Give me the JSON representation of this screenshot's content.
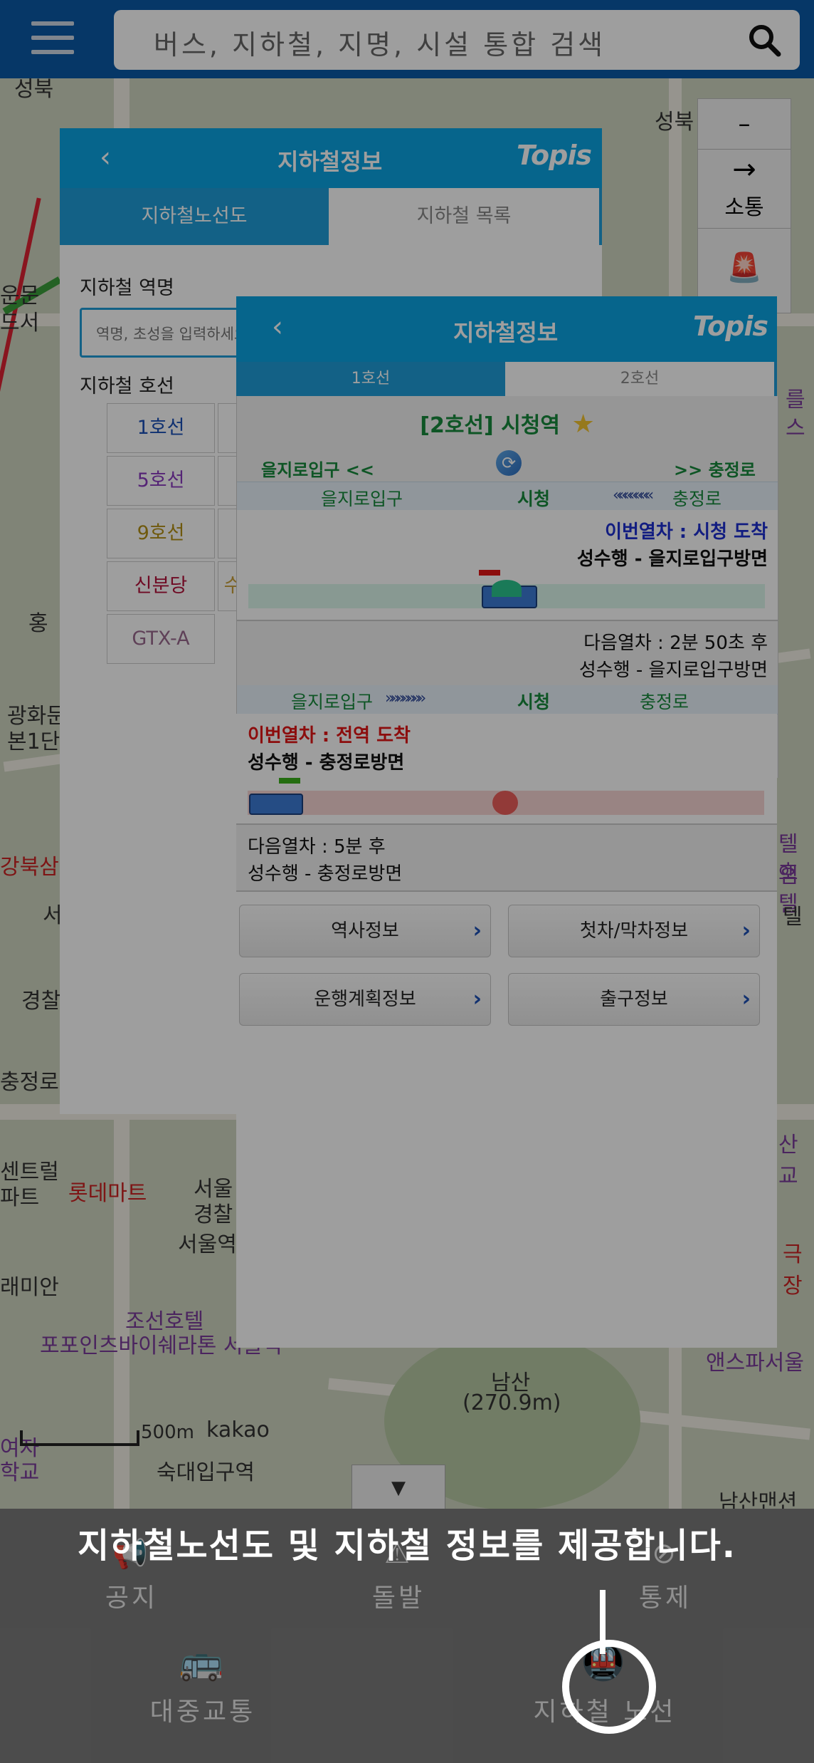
{
  "search": {
    "placeholder": "버스, 지하철, 지명, 시설 통합 검색"
  },
  "map": {
    "labels": [
      "성북",
      "성북",
      "운문",
      "드서",
      "홍",
      "광화문",
      "본1단",
      "강북삼",
      "서",
      "경찰",
      "충정로역",
      "센트럴",
      "파트",
      "롯데마트",
      "서울",
      "경찰",
      "서울역",
      "래미안",
      "조선호텔",
      "포포인츠바이쉐라톤 서울역",
      "남산",
      "(270.9m)",
      "여자",
      "학교",
      "숙대입구역",
      "앤스파서울",
      "남산맨션",
      "극장",
      "산교",
      "텔 앰",
      "호텔",
      "텔",
      "를",
      "스"
    ],
    "scale_label": "500m",
    "provider": "kakao",
    "right_controls": {
      "minus": "–",
      "nav_label": "소통"
    }
  },
  "panel1": {
    "title": "지하철정보",
    "brand": "Topis",
    "tabs": [
      "지하철노선도",
      "지하철 목록"
    ],
    "station_label": "지하철 역명",
    "station_placeholder": "역명, 초성을 입력하세요",
    "line_label": "지하철 호선",
    "lines": [
      {
        "label": "1호선",
        "color": "#1a4fb7"
      },
      {
        "label": "5호선",
        "color": "#8a3bbf"
      },
      {
        "label": "9호선",
        "color": "#b39015"
      },
      {
        "label": "신분당",
        "color": "#b3123b"
      },
      {
        "label": "GTX-A",
        "color": "#9a6a8e"
      }
    ],
    "peek_char": "수"
  },
  "panel2": {
    "title": "지하철정보",
    "brand": "Topis",
    "tabs": [
      "1호선",
      "2호선"
    ],
    "station_title": "[2호선] 시청역",
    "prev_nav": "을지로입구 <<",
    "next_nav": ">> 충정로",
    "dir1": {
      "left_station": "을지로입구",
      "center_station": "시청",
      "right_station": "충정로",
      "arrival_text": "이번열차 : 시청 도착",
      "train_text": "성수행 - 을지로입구방면",
      "next_train": "다음열차 : 2분 50초 후",
      "next_train_dest": "성수행 - 을지로입구방면"
    },
    "dir2": {
      "left_station": "을지로입구",
      "center_station": "시청",
      "right_station": "충정로",
      "arrival_text": "이번열차 : 전역 도착",
      "train_text": "성수행 - 충정로방면",
      "next_train": "다음열차 : 5분 후",
      "next_train_dest": "성수행 - 충정로방면"
    },
    "buttons": [
      "역사정보",
      "첫차/막차정보",
      "운행계획정보",
      "출구정보"
    ]
  },
  "bottom_nav": {
    "row1": [
      "공지",
      "돌발",
      "통제"
    ],
    "row2": [
      "대중교통",
      "지하철 노선"
    ]
  },
  "tip": "지하철노선도 및 지하철 정보를 제공합니다."
}
